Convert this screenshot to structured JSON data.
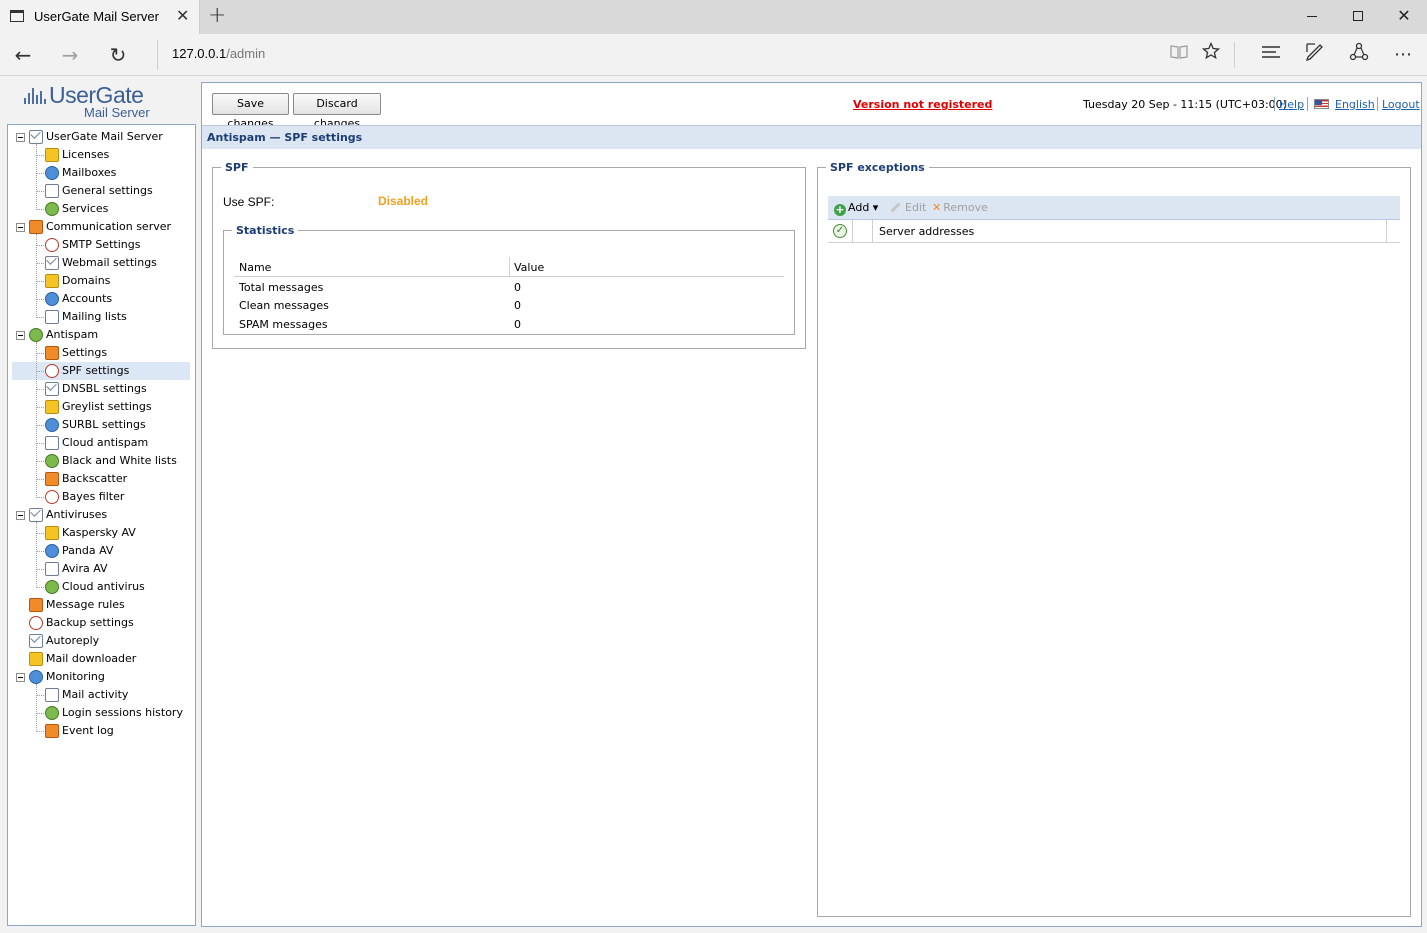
{
  "browser": {
    "tab_title": "UserGate Mail Server",
    "address_host": "127.0.0.1",
    "address_path": "/admin",
    "close_glyph": "✕",
    "new_tab_glyph": "+",
    "back_glyph": "←",
    "forward_glyph": "→",
    "refresh_glyph": "↻",
    "more_glyph": "⋯",
    "close_win_glyph": "✕"
  },
  "logo": {
    "name": "UserGate",
    "subtitle": "Mail Server"
  },
  "tree": [
    {
      "label": "UserGate Mail Server",
      "icon": "server-icon",
      "level": 0,
      "expandable": true
    },
    {
      "label": "Licenses",
      "icon": "license-icon",
      "level": 1
    },
    {
      "label": "Mailboxes",
      "icon": "mailbox-icon",
      "level": 1
    },
    {
      "label": "General settings",
      "icon": "general-settings-icon",
      "level": 1
    },
    {
      "label": "Services",
      "icon": "services-icon",
      "level": 1
    },
    {
      "label": "Communication server",
      "icon": "communication-icon",
      "level": 0,
      "expandable": true
    },
    {
      "label": "SMTP Settings",
      "icon": "smtp-icon",
      "level": 1
    },
    {
      "label": "Webmail settings",
      "icon": "webmail-icon",
      "level": 1
    },
    {
      "label": "Domains",
      "icon": "domains-icon",
      "level": 1
    },
    {
      "label": "Accounts",
      "icon": "accounts-icon",
      "level": 1
    },
    {
      "label": "Mailing lists",
      "icon": "mailing-lists-icon",
      "level": 1
    },
    {
      "label": "Antispam",
      "icon": "antispam-icon",
      "level": 0,
      "expandable": true
    },
    {
      "label": "Settings",
      "icon": "settings-icon",
      "level": 1
    },
    {
      "label": "SPF settings",
      "icon": "spf-icon",
      "level": 1,
      "selected": true
    },
    {
      "label": "DNSBL settings",
      "icon": "dnsbl-icon",
      "level": 1
    },
    {
      "label": "Greylist settings",
      "icon": "greylist-icon",
      "level": 1
    },
    {
      "label": "SURBL settings",
      "icon": "surbl-icon",
      "level": 1
    },
    {
      "label": "Cloud antispam",
      "icon": "cloud-antispam-icon",
      "level": 1
    },
    {
      "label": "Black and White lists",
      "icon": "lists-icon",
      "level": 1
    },
    {
      "label": "Backscatter",
      "icon": "backscatter-icon",
      "level": 1
    },
    {
      "label": "Bayes filter",
      "icon": "bayes-icon",
      "level": 1
    },
    {
      "label": "Antiviruses",
      "icon": "antivirus-icon",
      "level": 0,
      "expandable": true
    },
    {
      "label": "Kaspersky AV",
      "icon": "kaspersky-icon",
      "level": 1
    },
    {
      "label": "Panda AV",
      "icon": "panda-icon",
      "level": 1
    },
    {
      "label": "Avira AV",
      "icon": "avira-icon",
      "level": 1
    },
    {
      "label": "Cloud antivirus",
      "icon": "cloud-antivirus-icon",
      "level": 1
    },
    {
      "label": "Message rules",
      "icon": "message-rules-icon",
      "level": 0
    },
    {
      "label": "Backup settings",
      "icon": "backup-icon",
      "level": 0
    },
    {
      "label": "Autoreply",
      "icon": "autoreply-icon",
      "level": 0
    },
    {
      "label": "Mail downloader",
      "icon": "downloader-icon",
      "level": 0
    },
    {
      "label": "Monitoring",
      "icon": "monitoring-icon",
      "level": 0,
      "expandable": true
    },
    {
      "label": "Mail activity",
      "icon": "mail-activity-icon",
      "level": 1
    },
    {
      "label": "Login sessions history",
      "icon": "login-history-icon",
      "level": 1
    },
    {
      "label": "Event log",
      "icon": "event-log-icon",
      "level": 1
    }
  ],
  "toolbar": {
    "save_label": "Save changes",
    "discard_label": "Discard changes",
    "not_registered": "Version not registered",
    "datetime": "Tuesday 20 Sep - 11:15 (UTC+03:00)",
    "help": "Help",
    "language": "English",
    "logout": "Logout"
  },
  "section": {
    "title": "Antispam — SPF settings"
  },
  "spf": {
    "legend": "SPF",
    "use_spf_label": "Use SPF:",
    "use_spf_value": "Disabled",
    "status_color": "#f0a020",
    "statistics": {
      "legend": "Statistics",
      "columns": [
        "Name",
        "Value"
      ],
      "rows": [
        {
          "name": "Total messages",
          "value": "0"
        },
        {
          "name": "Clean messages",
          "value": "0"
        },
        {
          "name": "SPAM messages",
          "value": "0"
        }
      ]
    }
  },
  "exceptions": {
    "legend": "SPF exceptions",
    "add": "Add",
    "edit": "Edit",
    "remove": "Remove",
    "column": "Server addresses"
  }
}
